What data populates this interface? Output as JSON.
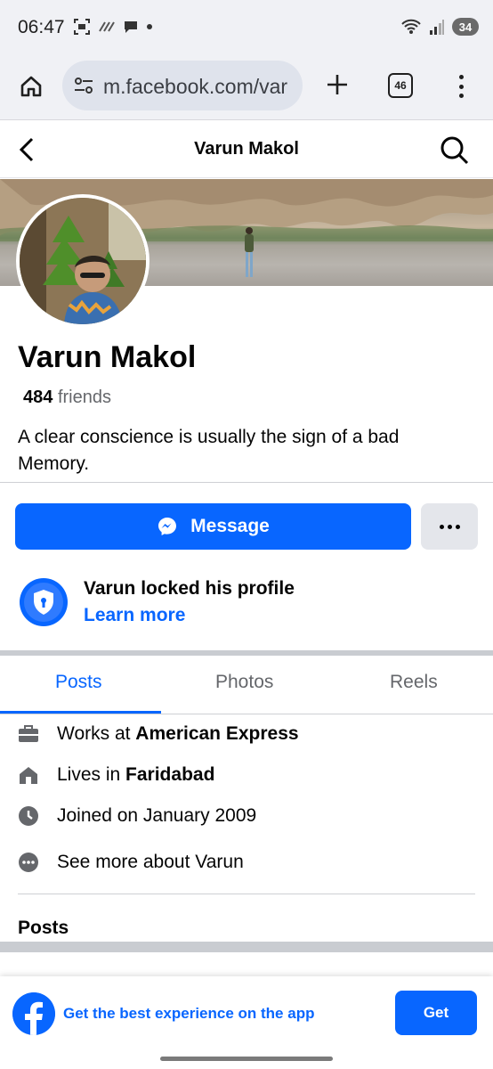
{
  "status_bar": {
    "time": "06:47",
    "battery": "34"
  },
  "browser": {
    "url": "m.facebook.com/var",
    "tab_count": "46"
  },
  "header": {
    "title": "Varun Makol"
  },
  "profile": {
    "name": "Varun Makol",
    "friends_count": "484",
    "friends_label": "friends",
    "bio": "A clear conscience is usually the sign of a bad Memory."
  },
  "actions": {
    "message_label": "Message"
  },
  "lock_notice": {
    "title": "Varun locked his profile",
    "link": "Learn more"
  },
  "tabs": [
    "Posts",
    "Photos",
    "Reels"
  ],
  "intro": {
    "work_prefix": "Works at ",
    "work_value": "American Express",
    "lives_prefix": "Lives in ",
    "lives_value": "Faridabad",
    "joined": "Joined on January 2009",
    "see_more": "See more about Varun"
  },
  "posts_heading": "Posts",
  "app_banner": {
    "text": "Get the best experience on the app",
    "button": "Get"
  },
  "colors": {
    "accent": "#0866ff",
    "secondary_text": "#65676b",
    "divider": "#c9ccd1"
  }
}
